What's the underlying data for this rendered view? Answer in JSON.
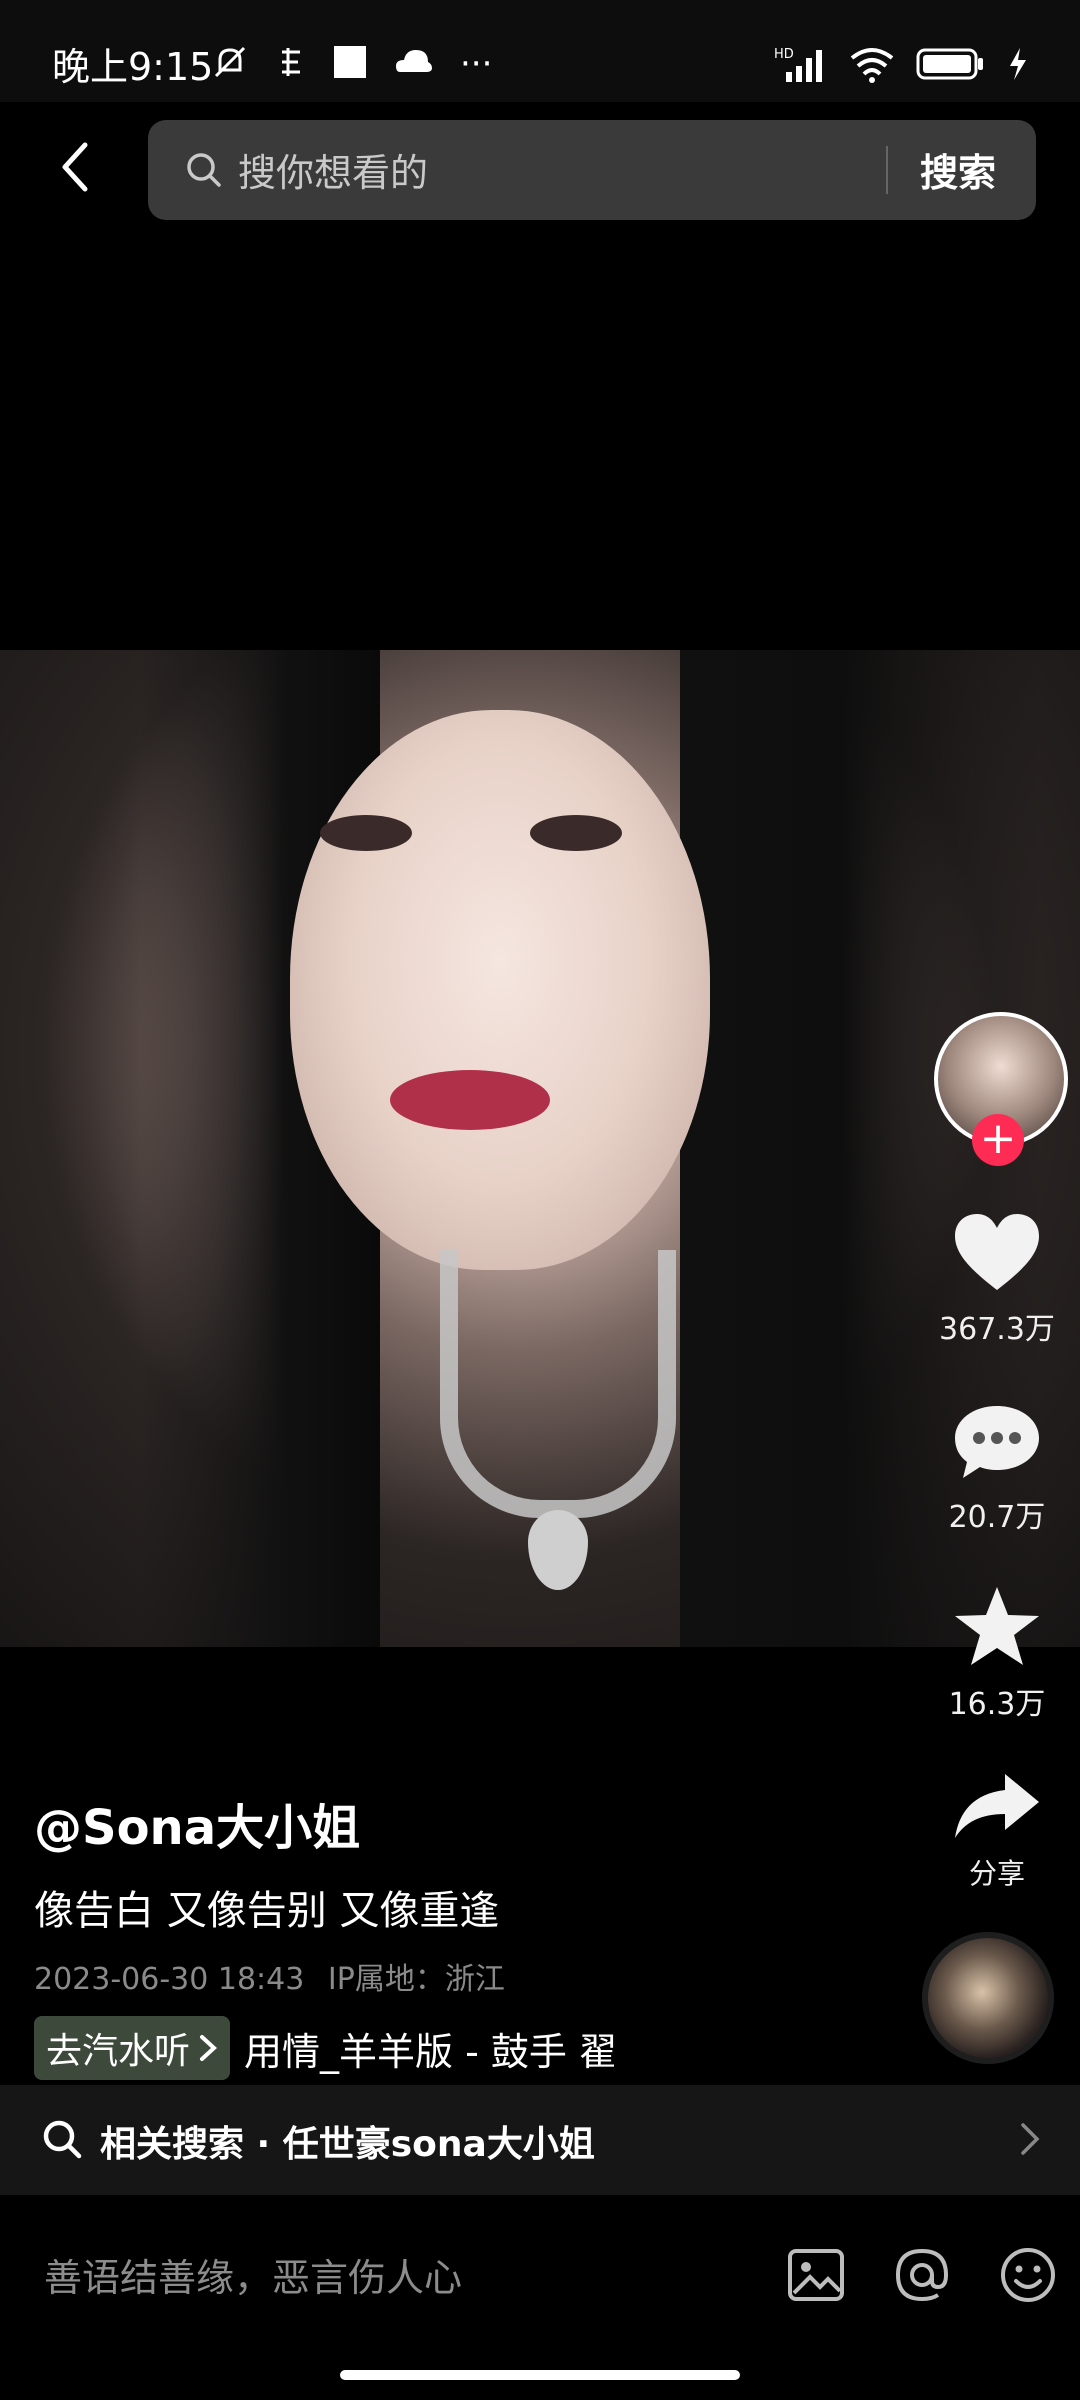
{
  "status_bar": {
    "time": "晚上9:15",
    "more": "···",
    "network_badge": "HD",
    "icons": [
      "mute-bell-icon",
      "notification-icon",
      "white-square-icon",
      "cloud-icon",
      "signal-icon",
      "wifi-icon",
      "battery-icon",
      "charging-icon"
    ]
  },
  "top_bar": {
    "back_icon": "back-chevron-icon",
    "search_placeholder": "搜你想看的",
    "search_button": "搜索"
  },
  "sidebar": {
    "follow_label": "+",
    "like_count": "367.3万",
    "comment_count": "20.7万",
    "favorite_count": "16.3万",
    "share_label": "分享"
  },
  "post": {
    "author": "@Sona大小姐",
    "description": "像告白 又像告别 又像重逢",
    "date": "2023-06-30 18:43",
    "ip_location": "IP属地：浙江",
    "music_chip": "去汽水听",
    "music_title": "用情_羊羊版 - 鼓手 翟"
  },
  "related_search": {
    "text": "相关搜索 · 任世豪sona大小姐"
  },
  "comment_bar": {
    "placeholder": "善语结善缘，恶言伤人心",
    "icons": [
      "image-icon",
      "at-icon",
      "emoji-icon"
    ]
  }
}
